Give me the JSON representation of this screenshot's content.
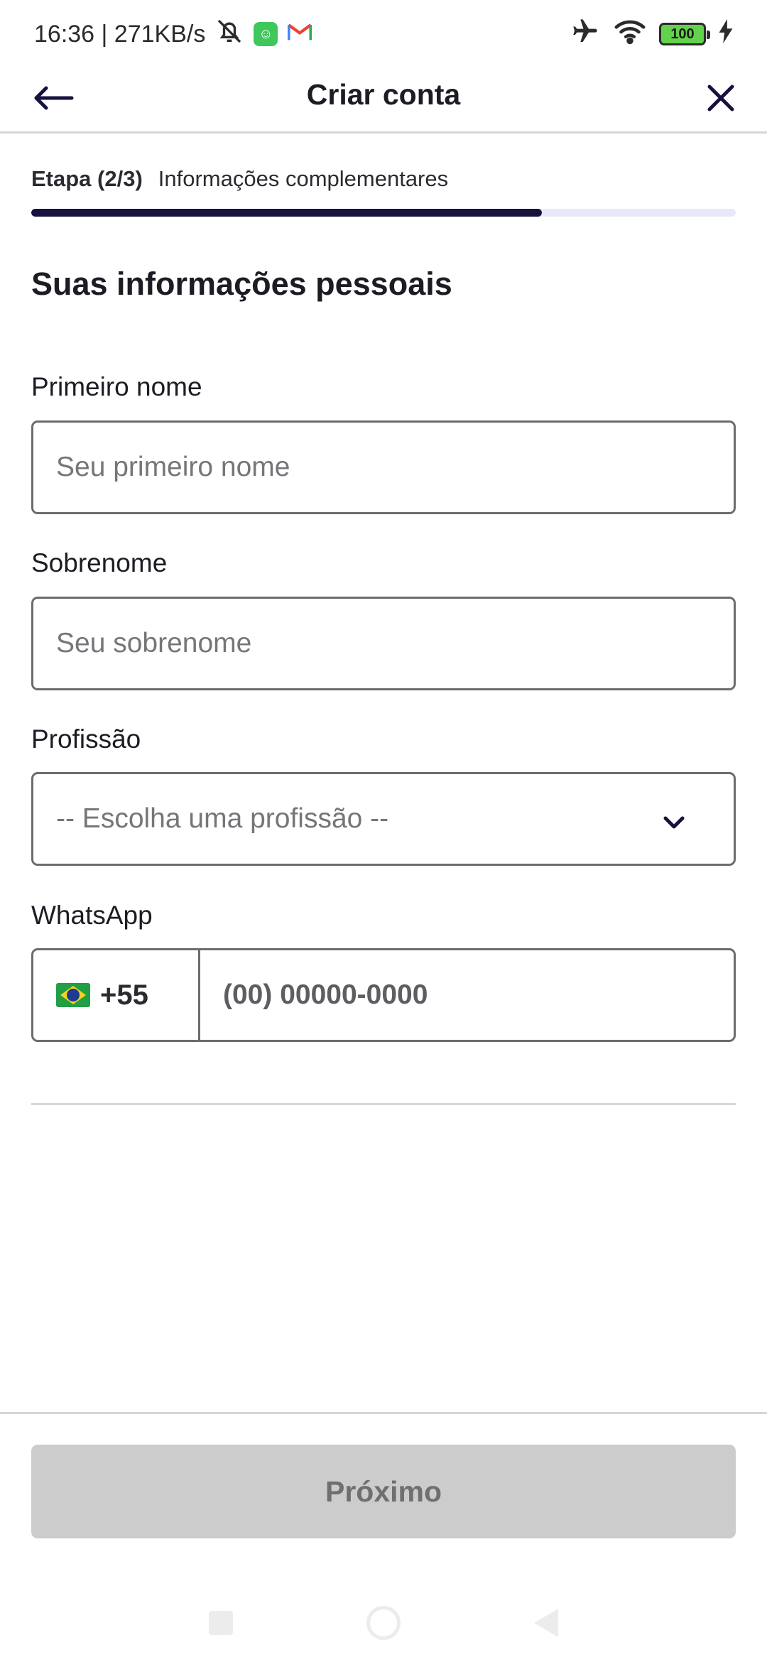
{
  "status_bar": {
    "time_speed": "16:36 | 271KB/s",
    "battery": "100"
  },
  "header": {
    "title": "Criar conta"
  },
  "step": {
    "number": "Etapa (2/3)",
    "name": "Informações complementares",
    "progress": 0.725
  },
  "section": {
    "title": "Suas informações pessoais"
  },
  "form": {
    "first_name": {
      "label": "Primeiro nome",
      "placeholder": "Seu primeiro nome"
    },
    "last_name": {
      "label": "Sobrenome",
      "placeholder": "Seu sobrenome"
    },
    "profession": {
      "label": "Profissão",
      "selected": "-- Escolha uma profissão --"
    },
    "whatsapp": {
      "label": "WhatsApp",
      "country_code": "+55",
      "placeholder": "(00) 00000-0000"
    }
  },
  "footer": {
    "next_label": "Próximo"
  },
  "icons": {
    "back": "arrow-left-icon",
    "close": "close-icon",
    "dropdown": "chevron-down-icon",
    "flag": "brazil-flag-icon"
  },
  "colors": {
    "primary": "#15123f",
    "progress_track": "#e8e8fb",
    "disabled_button": "#cccccc"
  }
}
